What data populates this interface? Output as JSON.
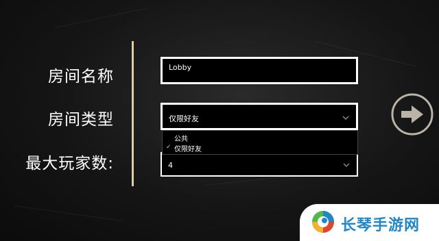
{
  "form": {
    "room_name_label": "房间名称",
    "room_type_label": "房间类型",
    "max_players_label": "最大玩家数:",
    "room_name_value": "Lobby",
    "room_type_value": "仅限好友",
    "room_type_options": [
      "公共",
      "仅限好友"
    ],
    "room_type_selected_index": 1,
    "max_players_value": "4"
  },
  "next_button": {
    "icon": "arrow-right-icon"
  },
  "watermark": {
    "text": "长琴手游网",
    "colors": {
      "blue": "#1f86c8",
      "red": "#e0462f",
      "green": "#53b848",
      "yellow": "#f2b12f"
    }
  }
}
